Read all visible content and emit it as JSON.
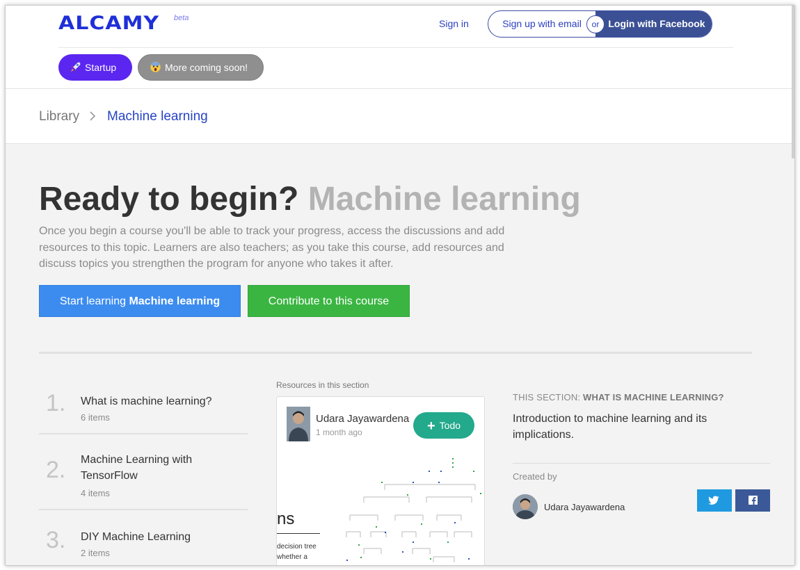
{
  "header": {
    "logo_text": "ALCAMY",
    "beta_label": "beta",
    "signin_label": "Sign in",
    "signup_email_label": "Sign up with email",
    "or_label": "or",
    "facebook_login_label": "Login with Facebook",
    "pills": [
      {
        "label": "Startup",
        "color": "#5b26f0"
      },
      {
        "label": "More coming soon!",
        "color": "#8f8f8f"
      }
    ]
  },
  "breadcrumb": {
    "library": "Library",
    "separator": ">",
    "current": "Machine learning"
  },
  "hero": {
    "title_prefix": "Ready to begin?",
    "title_topic": "Machine learning",
    "description": "Once you begin a course you'll be able to track your progress, access the discussions and add resources to this topic. Learners are also teachers; as you take this course, add resources and discuss topics you strengthen the program for anyone who takes it after.",
    "start_prefix": "Start learning",
    "start_topic": "Machine learning",
    "contribute_label": "Contribute to this course",
    "start_color": "#3c8cf0",
    "contribute_color": "#3bb542"
  },
  "sections": [
    {
      "number": "1.",
      "title": "What is machine learning?",
      "count": "6 items"
    },
    {
      "number": "2.",
      "title": "Machine Learning with TensorFlow",
      "count": "4 items"
    },
    {
      "number": "3.",
      "title": "DIY Machine Learning",
      "count": "2 items"
    }
  ],
  "resources": {
    "label": "Resources in this section",
    "card": {
      "author": "Udara Jayawardena",
      "time": "1 month ago",
      "todo_label": "Todo",
      "thumb_heading": "ns",
      "thumb_line1": "decision tree",
      "thumb_line2": "whether a"
    }
  },
  "section_info": {
    "prefix": "THIS SECTION:",
    "name": "WHAT IS MACHINE LEARNING?",
    "description": "Introduction to machine learning and its implications.",
    "created_by_label": "Created by",
    "creator_name": "Udara Jayawardena"
  }
}
